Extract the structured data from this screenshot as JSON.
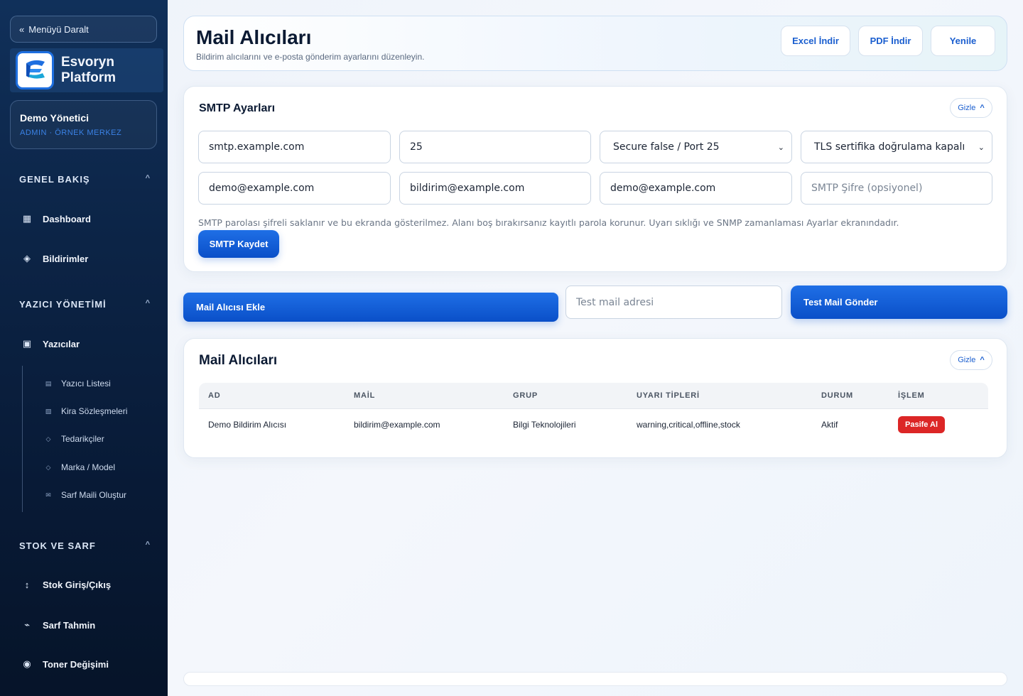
{
  "sidebar": {
    "collapse_label": "Menüyü Daralt",
    "collapse_icon": "«",
    "brand_line1": "Esvoryn",
    "brand_line2": "Platform",
    "user_name": "Demo Yönetici",
    "user_role": "ADMIN · ÖRNEK MERKEZ",
    "sections": {
      "overview": "GENEL BAKIŞ",
      "printers": "YAZICI YÖNETİMİ",
      "stock": "STOK VE SARF"
    },
    "chevron": "^",
    "items": {
      "dashboard": "Dashboard",
      "notifications": "Bildirimler",
      "printers": "Yazıcılar",
      "stock_io": "Stok Giriş/Çıkış",
      "consumption": "Sarf Tahmin",
      "toner": "Toner Değişimi"
    },
    "sub_items": {
      "printer_list": "Yazıcı Listesi",
      "leases": "Kira Sözleşmeleri",
      "suppliers": "Tedarikçiler",
      "brand_model": "Marka / Model",
      "supply_mail": "Sarf Maili Oluştur"
    },
    "icons": {
      "dashboard": "▦",
      "notifications": "◈",
      "printers": "▣",
      "printer_list": "▤",
      "leases": "▧",
      "suppliers": "◇",
      "brand_model": "◇",
      "supply_mail": "✉",
      "stock_io": "↕",
      "consumption": "⌁",
      "toner": "◉"
    }
  },
  "header": {
    "title": "Mail Alıcıları",
    "subtitle": "Bildirim alıcılarını ve e-posta gönderim ayarlarını düzenleyin.",
    "excel_label": "Excel İndir",
    "pdf_label": "PDF İndir",
    "refresh_label": "Yenile"
  },
  "smtp": {
    "title": "SMTP Ayarları",
    "hide_label": "Gizle",
    "hide_icon": "^",
    "host": "smtp.example.com",
    "port": "25",
    "secure_selected": "Secure false / Port 25",
    "tls_selected": "TLS sertifika doğrulama kapalı",
    "username": "demo@example.com",
    "from_address": "bildirim@example.com",
    "reply_to": "demo@example.com",
    "password_placeholder": "SMTP Şifre (opsiyonel)",
    "note": "SMTP parolası şifreli saklanır ve bu ekranda gösterilmez. Alanı boş bırakırsanız kayıtlı parola korunur. Uyarı sıklığı ve SNMP zamanlaması Ayarlar ekranındadır.",
    "save_label": "SMTP Kaydet"
  },
  "actions": {
    "add_recipient_label": "Mail Alıcısı Ekle",
    "test_placeholder": "Test mail adresi",
    "send_test_label": "Test Mail Gönder"
  },
  "recipients": {
    "title": "Mail Alıcıları",
    "hide_label": "Gizle",
    "columns": [
      "AD",
      "MAİL",
      "GRUP",
      "UYARI TİPLERİ",
      "DURUM",
      "İŞLEM"
    ],
    "rows": [
      {
        "name": "Demo Bildirim Alıcısı",
        "email": "bildirim@example.com",
        "group": "Bilgi Teknolojileri",
        "alert_types": "warning,critical,offline,stock",
        "status": "Aktif",
        "action": "Pasife Al"
      }
    ]
  },
  "colors": {
    "accent": "#1a5ecf",
    "danger": "#dc2626",
    "sidebar_bg": "#0c2446"
  }
}
